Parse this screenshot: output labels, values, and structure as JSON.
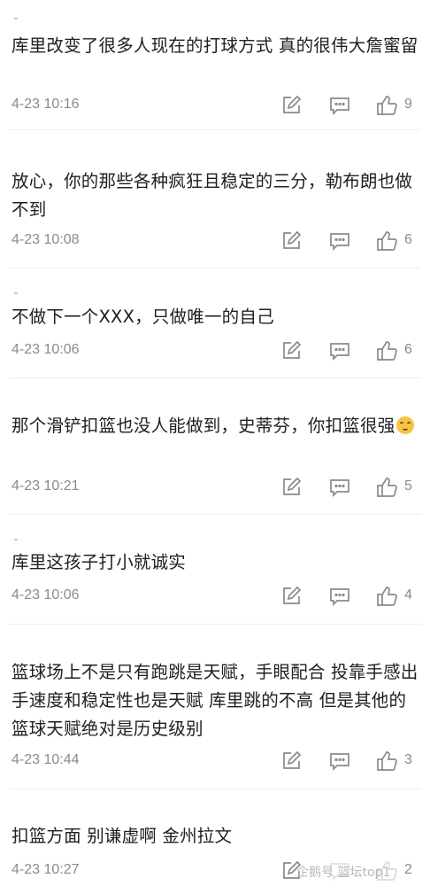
{
  "comments": [
    {
      "text": "库里改变了很多人现在的打球方式 真的很伟大詹蜜留",
      "time": "4-23 10:16",
      "likes": "9"
    },
    {
      "text": "放心，你的那些各种疯狂且稳定的三分，勒布朗也做不到",
      "time": "4-23 10:08",
      "likes": "6"
    },
    {
      "text": "不做下一个XXX，只做唯一的自己",
      "time": "4-23 10:06",
      "likes": "6"
    },
    {
      "text": "那个滑铲扣篮也没人能做到，史蒂芬，你扣篮很强",
      "time": "4-23 10:21",
      "likes": "5",
      "emoji": "doge-emoji"
    },
    {
      "text": "库里这孩子打小就诚实",
      "time": "4-23 10:06",
      "likes": "4"
    },
    {
      "text": "篮球场上不是只有跑跳是天赋，手眼配合 投靠手感出手速度和稳定性也是天赋  库里跳的不高 但是其他的篮球天赋绝对是历史级别",
      "time": "4-23 10:44",
      "likes": "3"
    },
    {
      "text": "扣篮方面 别谦虚啊 金州拉文",
      "time": "4-23 10:27",
      "likes": "2"
    }
  ],
  "watermark": "企鹅号 篮坛top1",
  "icons": {
    "edit": "edit-icon",
    "reply": "comment-icon",
    "like": "thumbs-up-icon"
  }
}
